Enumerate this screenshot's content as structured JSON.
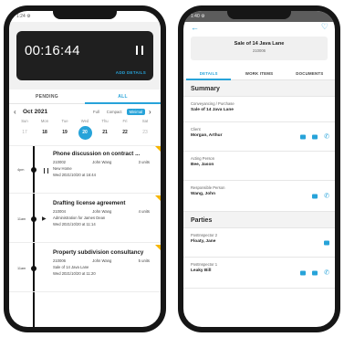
{
  "left": {
    "status_time": "1:24 ⚙",
    "timer": {
      "value": "00:16:44",
      "add_details": "ADD DETAILS"
    },
    "tabs": [
      {
        "label": "PENDING",
        "active": false
      },
      {
        "label": "ALL",
        "active": true
      }
    ],
    "calendar": {
      "month": "Oct 2021",
      "modes": [
        {
          "label": "Full",
          "active": false
        },
        {
          "label": "Compact",
          "active": false
        },
        {
          "label": "Minimal",
          "active": true
        }
      ],
      "days": [
        {
          "dow": "Sun",
          "num": "17",
          "dim": true,
          "selected": false
        },
        {
          "dow": "Mon",
          "num": "18",
          "dim": false,
          "selected": false
        },
        {
          "dow": "Tue",
          "num": "19",
          "dim": false,
          "selected": false
        },
        {
          "dow": "Wed",
          "num": "20",
          "dim": false,
          "selected": true
        },
        {
          "dow": "Thu",
          "num": "21",
          "dim": false,
          "selected": false
        },
        {
          "dow": "Fri",
          "num": "22",
          "dim": false,
          "selected": false
        },
        {
          "dow": "Sat",
          "num": "23",
          "dim": true,
          "selected": false
        }
      ]
    },
    "entries": [
      {
        "time": "4pm",
        "control": "pause",
        "title": "Phone discussion on contract ...",
        "code": "210002",
        "person": "John Wang",
        "units": "3 units",
        "detail": "New Home",
        "date": "Wed 2021/10/20 at 16:44"
      },
      {
        "time": "11am",
        "control": "play",
        "title": "Drafting license agreement",
        "code": "210004",
        "person": "John Wang",
        "units": "4 units",
        "detail": "Administration for James Dean",
        "date": "Wed 2021/10/20 at 11:14"
      },
      {
        "time": "11am",
        "control": "none",
        "title": "Property subdivision consultancy",
        "code": "210006",
        "person": "John Wang",
        "units": "5 units",
        "detail": "Sale of 14 Java Lane",
        "date": "Wed 2021/10/20 at 11:20"
      }
    ],
    "accent": "#27a3d9",
    "flag_color": "#f5b400"
  },
  "right": {
    "status_time": "1:40 ⚙",
    "header": {
      "title": "Sale of 14 Java Lane",
      "subtitle": "210006"
    },
    "tabs": [
      {
        "label": "DETAILS",
        "active": true
      },
      {
        "label": "WORK ITEMS",
        "active": false
      },
      {
        "label": "DOCUMENTS",
        "active": false
      }
    ],
    "summary_title": "Summary",
    "summary_fields": [
      {
        "label": "Conveyancing / Purchase",
        "value": "Sale of 14 Java Lane",
        "actions": []
      },
      {
        "label": "Client",
        "value": "Morgan, Arthur",
        "actions": [
          "mail",
          "chat",
          "phone"
        ]
      },
      {
        "label": "Acting Person",
        "value": "Bee, Jason",
        "actions": []
      },
      {
        "label": "Responsible Person",
        "value": "Wang, John",
        "actions": [
          "mail",
          "phone"
        ]
      }
    ],
    "parties_title": "Parties",
    "party_fields": [
      {
        "label": "PostInspector 2",
        "value": "Floaty, Jane",
        "actions": [
          "mail"
        ]
      },
      {
        "label": "PostInspector 1",
        "value": "Leaky Bill",
        "actions": [
          "mail",
          "chat",
          "phone"
        ]
      }
    ]
  }
}
